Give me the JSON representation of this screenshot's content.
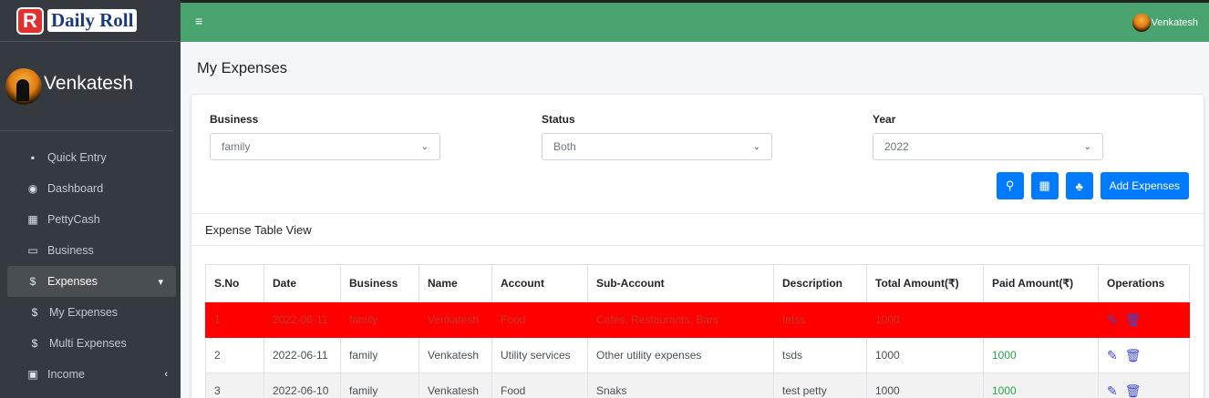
{
  "brand": {
    "letter": "R",
    "name": "Daily Roll"
  },
  "user": {
    "name": "Venkatesh"
  },
  "topbar": {
    "menu_icon": "hamburger-icon",
    "user_name": "Venkatesh"
  },
  "sidebar": {
    "items": [
      {
        "label": "Quick Entry",
        "icon": "book-icon"
      },
      {
        "label": "Dashboard",
        "icon": "dashboard-icon"
      },
      {
        "label": "PettyCash",
        "icon": "calculator-icon"
      },
      {
        "label": "Business",
        "icon": "card-icon"
      },
      {
        "label": "Expenses",
        "icon": "dollar-icon",
        "active": true
      },
      {
        "label": "My Expenses",
        "icon": "dollar-icon"
      },
      {
        "label": "Multi Expenses",
        "icon": "dollar-icon"
      },
      {
        "label": "Income",
        "icon": "money-icon"
      }
    ]
  },
  "page": {
    "title": "My Expenses"
  },
  "filters": {
    "business": {
      "label": "Business",
      "value": "family"
    },
    "status": {
      "label": "Status",
      "value": "Both"
    },
    "year": {
      "label": "Year",
      "value": "2022"
    }
  },
  "buttons": {
    "add_label": "Add Expenses"
  },
  "section": {
    "title": "Expense Table View"
  },
  "table": {
    "headers": [
      "S.No",
      "Date",
      "Business",
      "Name",
      "Account",
      "Sub-Account",
      "Description",
      "Total Amount(₹)",
      "Paid Amount(₹)",
      "Operations"
    ],
    "rows": [
      [
        "1",
        "2022-06-11",
        "family",
        "Venkatesh",
        "Food",
        "Cafes, Restaurants, Bars",
        "tetss",
        "1000",
        ""
      ],
      [
        "2",
        "2022-06-11",
        "family",
        "Venkatesh",
        "Utility services",
        "Other utility expenses",
        "tsds",
        "1000",
        "1000"
      ],
      [
        "3",
        "2022-06-10",
        "family",
        "Venkatesh",
        "Food",
        "Snaks",
        "test petty",
        "1000",
        "1000"
      ]
    ]
  },
  "colors": {
    "topbar": "#49a36e",
    "sidebar": "#343a40",
    "primary": "#007bff",
    "highlight_row": "#ff0000",
    "paid": "#28a745"
  }
}
